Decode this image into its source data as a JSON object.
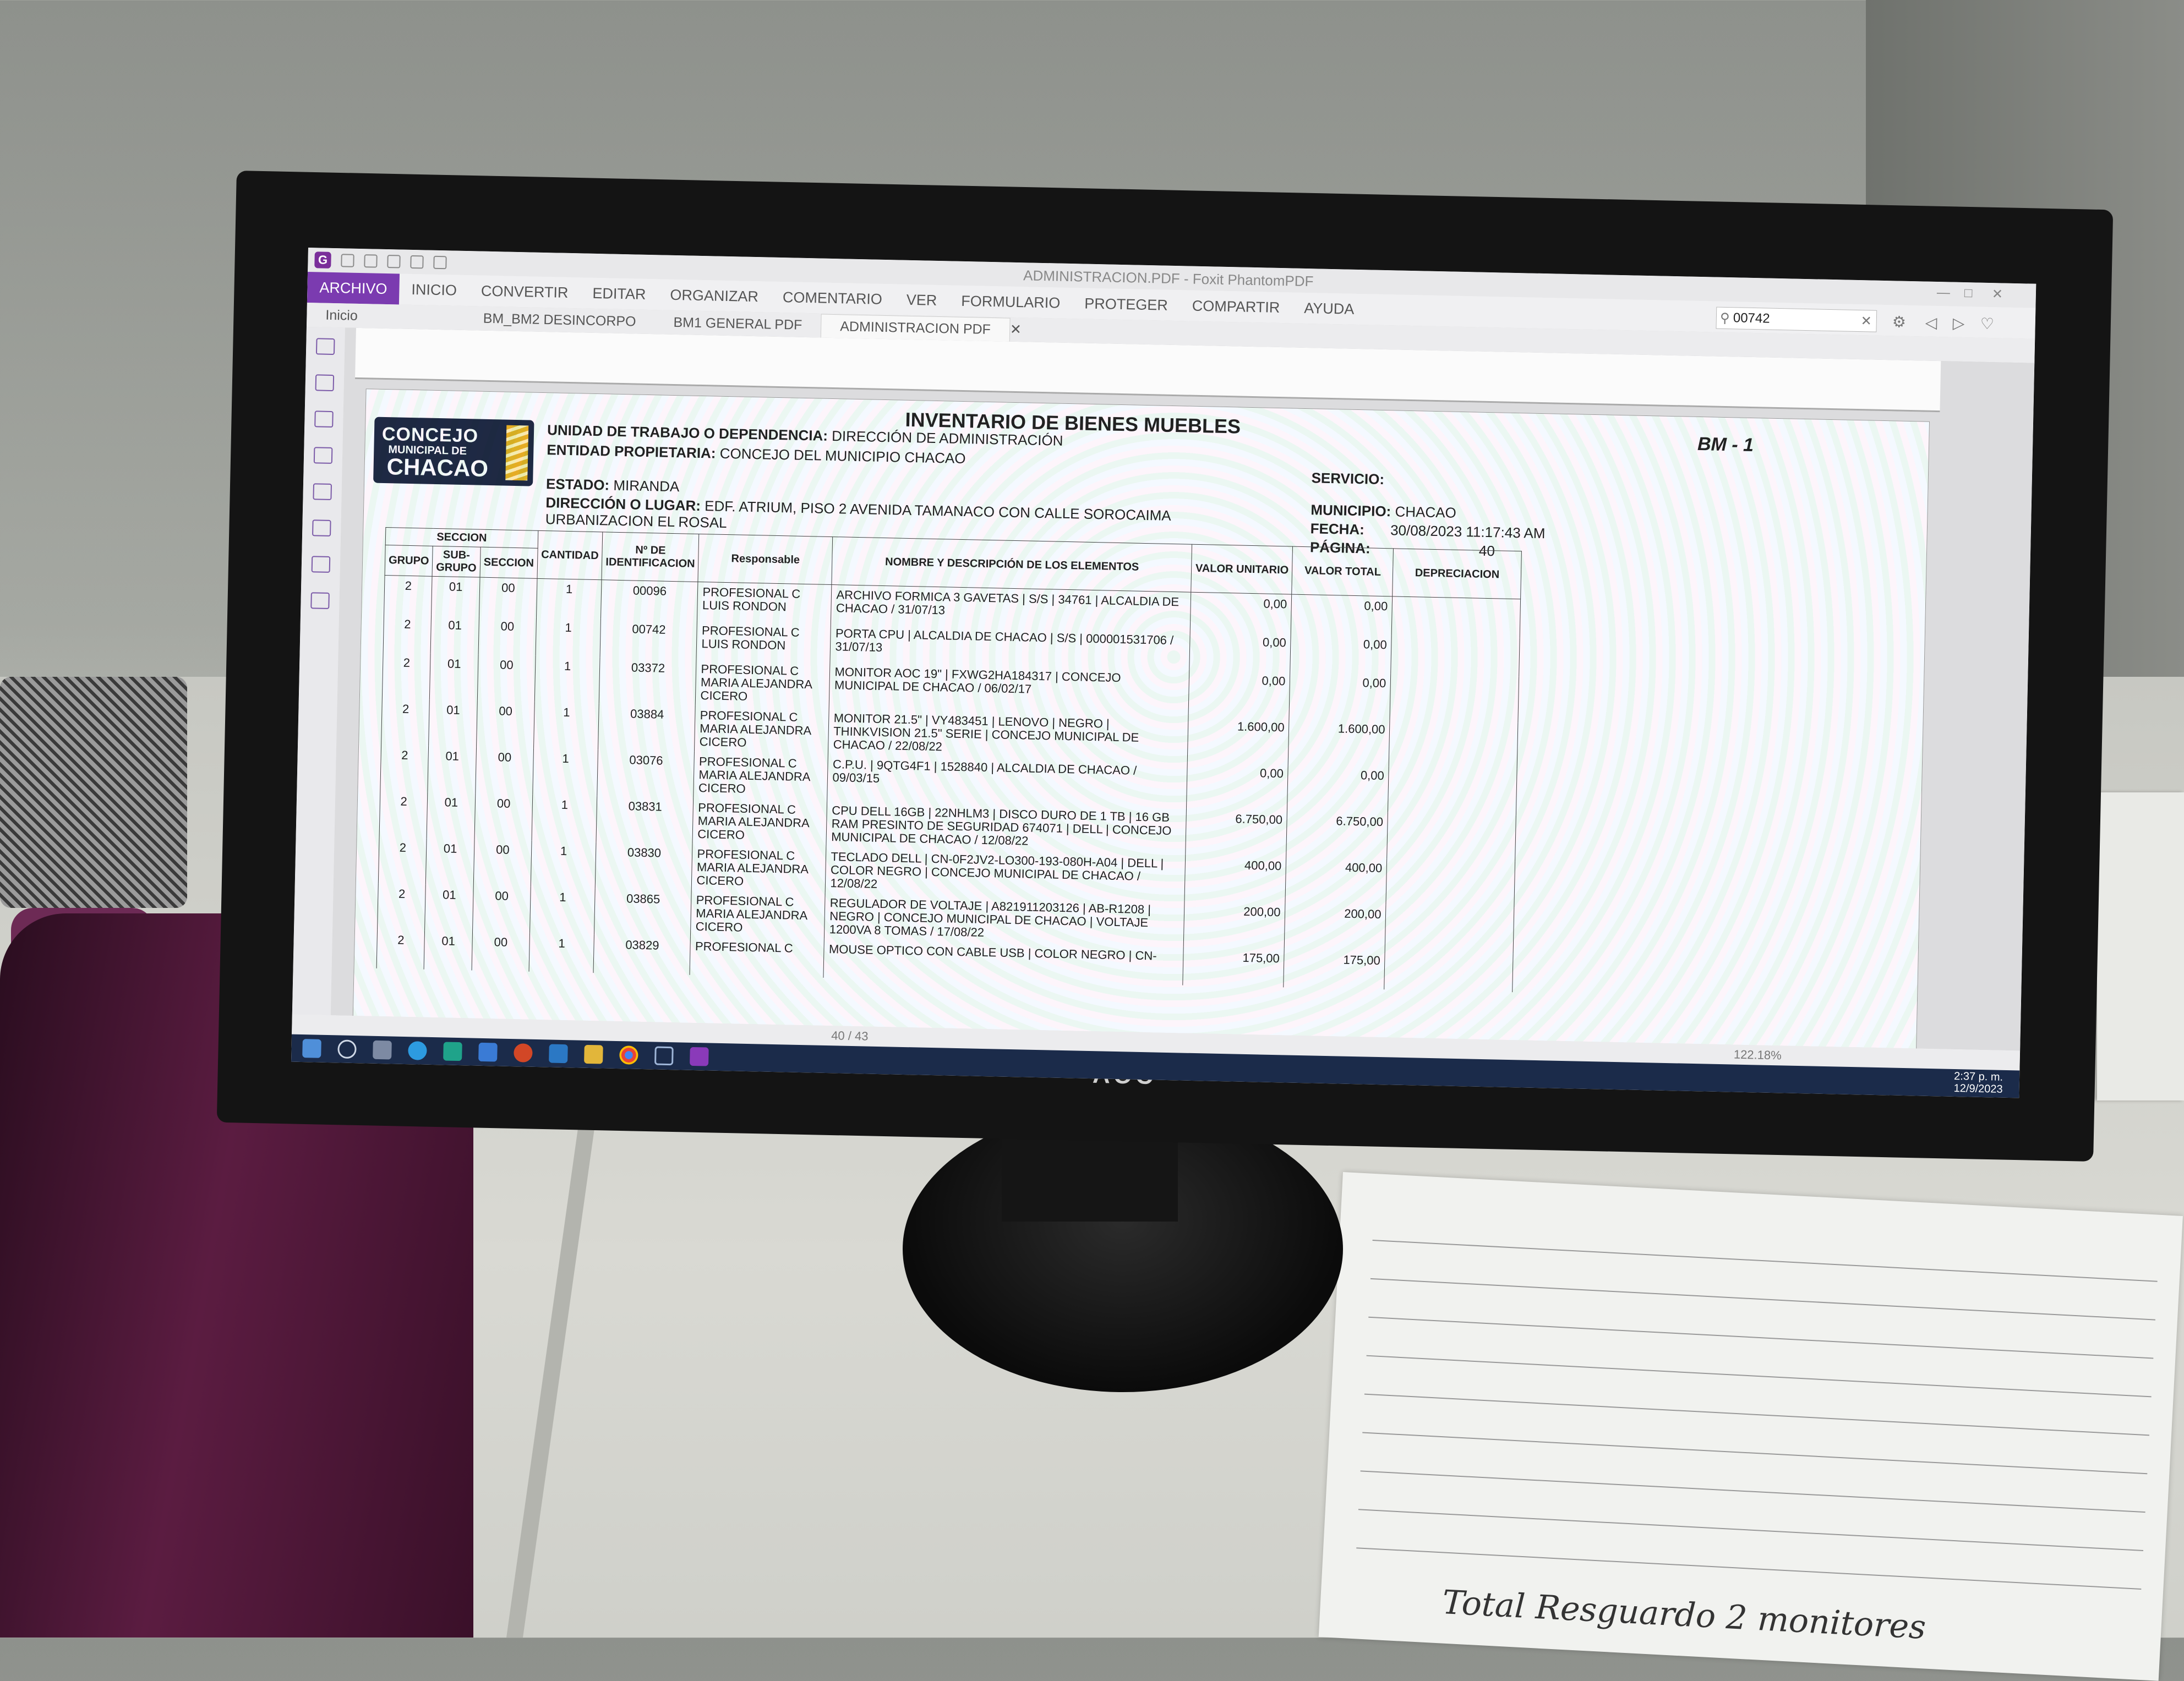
{
  "window": {
    "title": "ADMINISTRACION.PDF - Foxit PhantomPDF",
    "brand": "AOC"
  },
  "ribbon": {
    "tabs": [
      "ARCHIVO",
      "INICIO",
      "CONVERTIR",
      "EDITAR",
      "ORGANIZAR",
      "COMENTARIO",
      "VER",
      "FORMULARIO",
      "PROTEGER",
      "COMPARTIR",
      "AYUDA"
    ]
  },
  "search": {
    "value": "00742"
  },
  "doc_tabs": [
    "Inicio",
    "BM_BM2 DESINCORPO",
    "BM1 GENERAL PDF",
    "ADMINISTRACION PDF"
  ],
  "document": {
    "title": "INVENTARIO DE BIENES MUEBLES",
    "code": "BM - 1",
    "logo": {
      "line1": "CONCEJO",
      "line2": "MUNICIPAL DE",
      "line3": "CHACAO"
    },
    "unidad_label": "UNIDAD DE TRABAJO O DEPENDENCIA:",
    "unidad_value": "DIRECCIÓN DE ADMINISTRACIÓN",
    "entidad_label": "ENTIDAD PROPIETARIA:",
    "entidad_value": "CONCEJO DEL MUNICIPIO CHACAO",
    "estado_label": "ESTADO:",
    "estado_value": "MIRANDA",
    "direccion_label": "DIRECCIÓN O LUGAR:",
    "direccion_value": "EDF. ATRIUM, PISO 2 AVENIDA TAMANACO CON CALLE SOROCAIMA",
    "direccion_value2": "URBANIZACION EL ROSAL",
    "servicio_label": "SERVICIO:",
    "municipio_label": "MUNICIPIO:",
    "municipio_value": "CHACAO",
    "fecha_label": "FECHA:",
    "fecha_value": "30/08/2023 11:17:43 AM",
    "pagina_label": "PÁGINA:",
    "pagina_value": "40",
    "headers": {
      "seccion": "SECCION",
      "grupo": "GRUPO",
      "subgrupo": "SUB-GRUPO",
      "seccion2": "SECCION",
      "cantidad": "CANTIDAD",
      "identificacion": "Nº DE IDENTIFICACION",
      "responsable": "Responsable",
      "descripcion": "NOMBRE Y DESCRIPCIÓN DE LOS ELEMENTOS",
      "valor_unitario": "VALOR UNITARIO",
      "valor_total": "VALOR TOTAL",
      "depreciacion": "DEPRECIACION"
    },
    "rows": [
      {
        "g": "2",
        "sg": "01",
        "s": "00",
        "c": "1",
        "id": "00096",
        "resp": "PROFESIONAL C LUIS RONDON",
        "desc": "ARCHIVO FORMICA 3 GAVETAS | S/S | 34761 | ALCALDIA DE CHACAO / 31/07/13",
        "vu": "0,00",
        "vt": "0,00"
      },
      {
        "g": "2",
        "sg": "01",
        "s": "00",
        "c": "1",
        "id": "00742",
        "resp": "PROFESIONAL C LUIS RONDON",
        "desc": "PORTA CPU | ALCALDIA DE CHACAO | S/S | 000001531706 / 31/07/13",
        "vu": "0,00",
        "vt": "0,00"
      },
      {
        "g": "2",
        "sg": "01",
        "s": "00",
        "c": "1",
        "id": "03372",
        "resp": "PROFESIONAL C MARIA ALEJANDRA CICERO",
        "desc": "MONITOR AOC 19\" | FXWG2HA184317 | CONCEJO MUNICIPAL DE CHACAO / 06/02/17",
        "vu": "0,00",
        "vt": "0,00"
      },
      {
        "g": "2",
        "sg": "01",
        "s": "00",
        "c": "1",
        "id": "03884",
        "resp": "PROFESIONAL C MARIA ALEJANDRA CICERO",
        "desc": "MONITOR 21.5\" | VY483451 | LENOVO | NEGRO | THINKVISION 21.5\" SERIE | CONCEJO MUNICIPAL DE CHACAO / 22/08/22",
        "vu": "1.600,00",
        "vt": "1.600,00"
      },
      {
        "g": "2",
        "sg": "01",
        "s": "00",
        "c": "1",
        "id": "03076",
        "resp": "PROFESIONAL C MARIA ALEJANDRA CICERO",
        "desc": "C.P.U. | 9QTG4F1 | 1528840 | ALCALDIA DE CHACAO / 09/03/15",
        "vu": "0,00",
        "vt": "0,00"
      },
      {
        "g": "2",
        "sg": "01",
        "s": "00",
        "c": "1",
        "id": "03831",
        "resp": "PROFESIONAL C MARIA ALEJANDRA CICERO",
        "desc": "CPU DELL 16GB | 22NHLM3 | DISCO DURO DE 1 TB | 16 GB RAM PRESINTO DE SEGURIDAD 674071 | DELL | CONCEJO MUNICIPAL DE CHACAO / 12/08/22",
        "vu": "6.750,00",
        "vt": "6.750,00"
      },
      {
        "g": "2",
        "sg": "01",
        "s": "00",
        "c": "1",
        "id": "03830",
        "resp": "PROFESIONAL C MARIA ALEJANDRA CICERO",
        "desc": "TECLADO DELL | CN-0F2JV2-LO300-193-080H-A04 | DELL | COLOR NEGRO | CONCEJO MUNICIPAL DE CHACAO / 12/08/22",
        "vu": "400,00",
        "vt": "400,00"
      },
      {
        "g": "2",
        "sg": "01",
        "s": "00",
        "c": "1",
        "id": "03865",
        "resp": "PROFESIONAL C MARIA ALEJANDRA CICERO",
        "desc": "REGULADOR DE VOLTAJE | A821911203126 | AB-R1208 | NEGRO | CONCEJO MUNICIPAL DE CHACAO | VOLTAJE 1200VA 8 TOMAS / 17/08/22",
        "vu": "200,00",
        "vt": "200,00"
      },
      {
        "g": "2",
        "sg": "01",
        "s": "00",
        "c": "1",
        "id": "03829",
        "resp": "PROFESIONAL C",
        "desc": "MOUSE OPTICO CON CABLE USB | COLOR NEGRO | CN-",
        "vu": "175,00",
        "vt": "175,00"
      }
    ]
  },
  "status": {
    "page": "40 / 43",
    "zoom": "122.18%"
  },
  "taskbar": {
    "time": "2:37 p. m.",
    "date": "12/9/2023"
  },
  "desk_paper": {
    "note": "Total Resguardo 2 monitores"
  }
}
